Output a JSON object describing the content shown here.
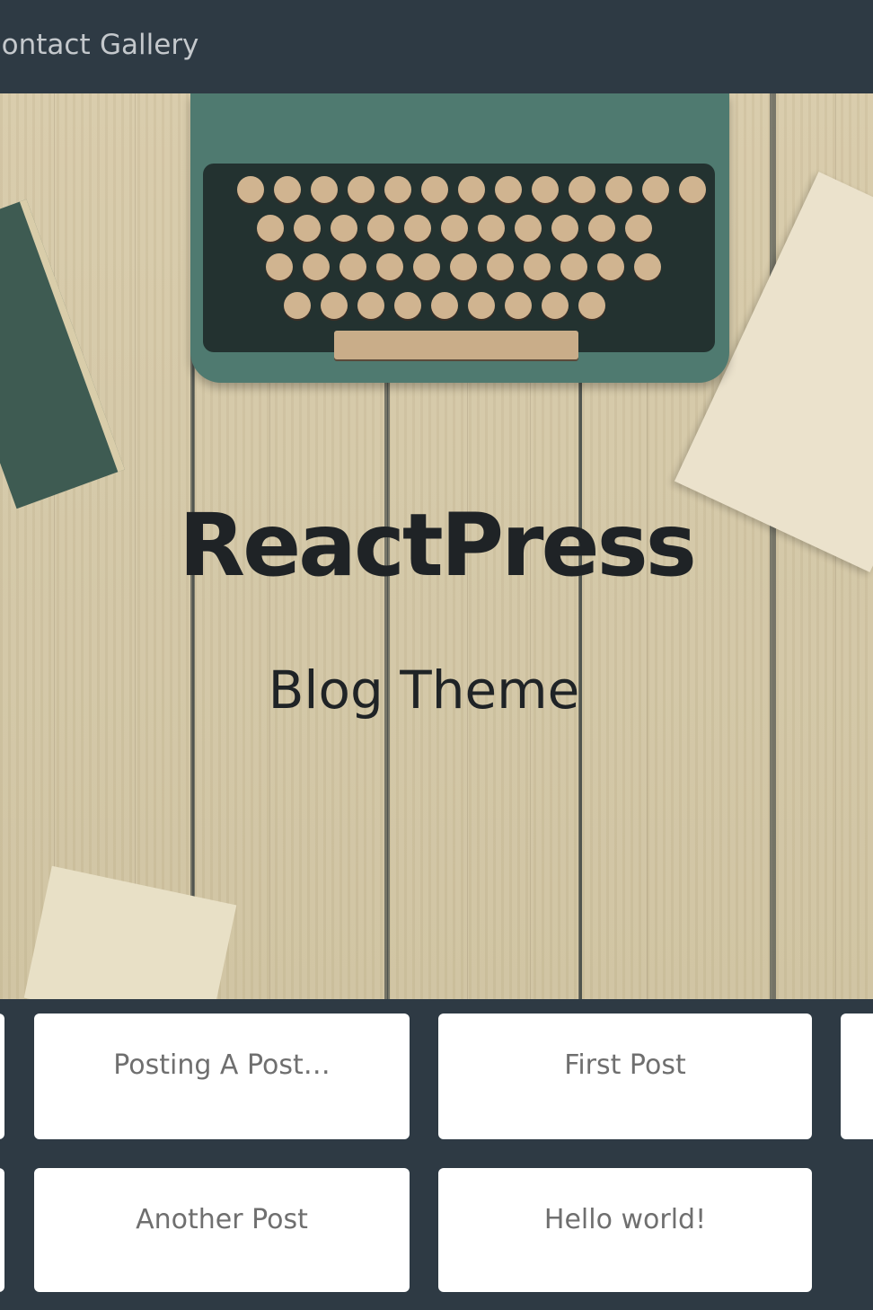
{
  "nav": {
    "items": [
      {
        "label": "Contact"
      },
      {
        "label": "Gallery"
      }
    ]
  },
  "hero": {
    "title": "ReactPress",
    "subtitle": "Blog Theme"
  },
  "posts": [
    {
      "title": "Posting A Post…"
    },
    {
      "title": "First Post"
    },
    {
      "title": "Another Post"
    },
    {
      "title": "Hello world!"
    }
  ],
  "colors": {
    "background": "#2e3a44",
    "card": "#ffffff",
    "hero_text": "#1f2326",
    "nav_text": "#c4c8cc"
  }
}
